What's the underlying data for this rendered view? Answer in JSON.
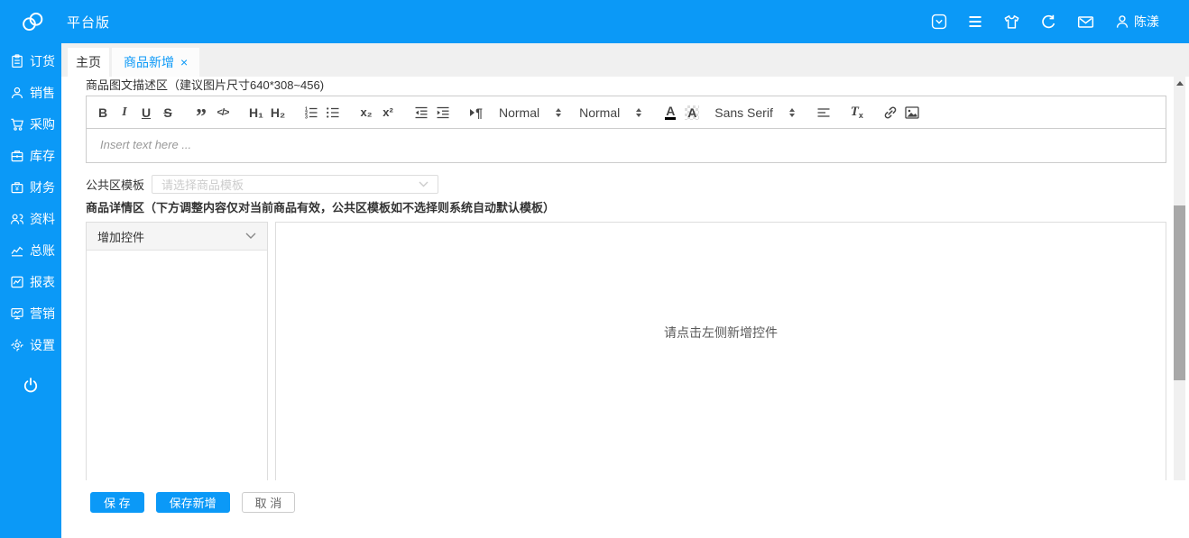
{
  "colors": {
    "primary": "#0b99f7",
    "toolbar_icon": "#444444",
    "scroll_thumb": "#a8a8a8"
  },
  "header": {
    "app_title": "平台版",
    "username": "陈漾"
  },
  "sidebar": {
    "items": [
      {
        "label": "订货"
      },
      {
        "label": "销售"
      },
      {
        "label": "采购"
      },
      {
        "label": "库存"
      },
      {
        "label": "财务"
      },
      {
        "label": "资料"
      },
      {
        "label": "总账"
      },
      {
        "label": "报表"
      },
      {
        "label": "营销"
      },
      {
        "label": "设置"
      }
    ]
  },
  "tabs": {
    "home": "主页",
    "product_new": "商品新增",
    "close_glyph": "×"
  },
  "main": {
    "desc_section_label": "商品图文描述区（建议图片尺寸640*308~456)",
    "editor": {
      "placeholder": "Insert text here ...",
      "toolbar": {
        "bold": "B",
        "italic": "I",
        "underline": "U",
        "strike": "S",
        "quote_glyph": "”",
        "code": "</>",
        "h1": "H₁",
        "h2": "H₂",
        "subscript": "x₂",
        "superscript": "x²",
        "pilcrow": "¶",
        "size_value": "Normal",
        "header_value": "Normal",
        "color_letter": "A",
        "background_letter": "A",
        "font_value": "Sans Serif",
        "clean_t": "T",
        "clean_x": "x"
      }
    },
    "template_field": {
      "label": "公共区模板",
      "placeholder": "请选择商品模板"
    },
    "detail_section_label": "商品详情区（下方调整内容仅对当前商品有效，公共区模板如不选择则系统自动默认模板）",
    "widget_panel": {
      "dropdown_label": "增加控件"
    },
    "canvas_hint": "请点击左侧新增控件"
  },
  "footer": {
    "save": "保  存",
    "save_and_new": "保存新增",
    "cancel": "取  消"
  }
}
